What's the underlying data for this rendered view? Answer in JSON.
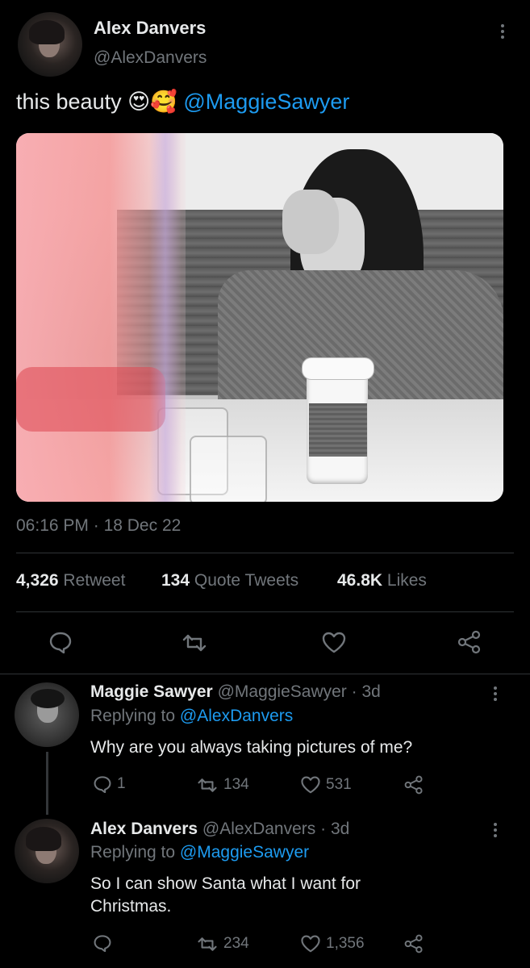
{
  "tweet": {
    "author_name": "Alex Danvers",
    "author_handle": "@AlexDanvers",
    "text": "this beauty",
    "emoji": "😍🥰",
    "mention": "@MaggieSawyer",
    "time": "06:16 PM",
    "sep": "·",
    "date": "18 Dec 22",
    "stats": {
      "retweets_count": "4,326",
      "retweets_label": "Retweet",
      "quotes_count": "134",
      "quotes_label": "Quote Tweets",
      "likes_count": "46.8K",
      "likes_label": "Likes"
    }
  },
  "replies": [
    {
      "name": "Maggie Sawyer",
      "handle": "@MaggieSawyer",
      "age": "· 3d",
      "replying_prefix": "Replying to",
      "replying_to": "@AlexDanvers",
      "text": "Why are you always taking pictures of me?",
      "reply_count": "1",
      "retweet_count": "134",
      "like_count": "531"
    },
    {
      "name": "Alex Danvers",
      "handle": "@AlexDanvers",
      "age": "· 3d",
      "replying_prefix": "Replying to",
      "replying_to": "@MaggieSawyer",
      "text": "So I can show Santa what I want for Christmas.",
      "reply_count": "",
      "retweet_count": "234",
      "like_count": "1,356"
    }
  ],
  "colors": {
    "background": "#000000",
    "text": "#e7e9ea",
    "muted": "#71767b",
    "link": "#1d9bf0"
  }
}
